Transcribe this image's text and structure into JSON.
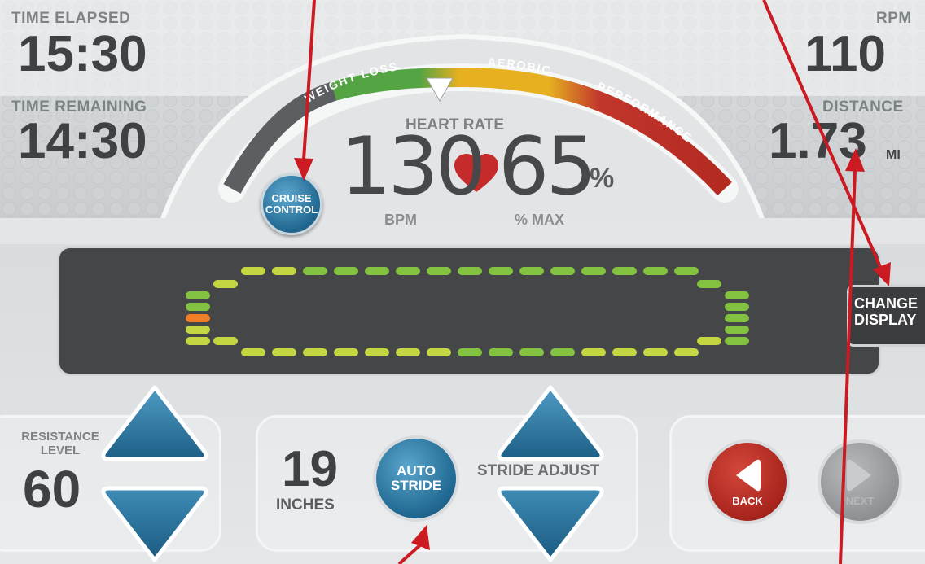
{
  "metrics": {
    "time_elapsed_label": "TIME ELAPSED",
    "time_elapsed_value": "15:30",
    "time_remaining_label": "TIME REMAINING",
    "time_remaining_value": "14:30",
    "rpm_label": "RPM",
    "rpm_value": "110",
    "distance_label": "DISTANCE",
    "distance_value": "1.73",
    "distance_unit": "MI"
  },
  "heart_rate": {
    "zones": [
      "WEIGHT LOSS",
      "AEROBIC",
      "PERFORMANCE"
    ],
    "label": "HEART RATE",
    "bpm_value": "130",
    "bpm_label": "BPM",
    "percent_value": "65",
    "percent_sign": "%",
    "percent_label": "% MAX"
  },
  "buttons": {
    "cruise_control_line1": "CRUISE",
    "cruise_control_line2": "CONTROL",
    "change_display_line1": "CHANGE",
    "change_display_line2": "DISPLAY",
    "auto_stride_line1": "AUTO",
    "auto_stride_line2": "STRIDE",
    "back": "BACK",
    "next": "NEXT"
  },
  "resistance": {
    "label_line1": "RESISTANCE",
    "label_line2": "LEVEL",
    "value": "60"
  },
  "stride": {
    "value": "19",
    "unit": "INCHES",
    "adjust_label": "STRIDE ADJUST"
  },
  "colors": {
    "accent_blue": "#2a7aa6",
    "back_red": "#b32a20",
    "next_gray": "#9b9ea0",
    "annotation_arrow": "#cc1a22",
    "zone_weight_loss": "#55a444",
    "zone_aerobic": "#e6b020",
    "zone_performance": "#c2362c",
    "track_green": "#84c341",
    "track_yellow": "#c4d743",
    "track_orange": "#f07e26"
  }
}
